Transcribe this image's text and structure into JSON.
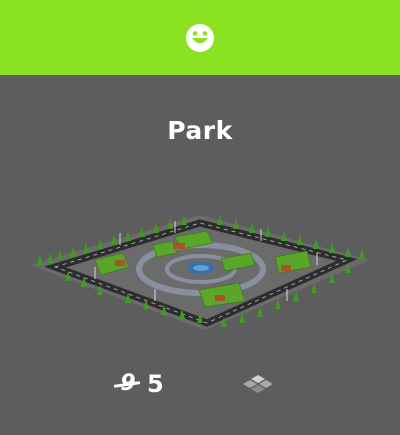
{
  "header": {
    "color": "#8be220",
    "icon": "smiley-icon"
  },
  "building": {
    "name": "Park",
    "illustration": "park-illustration",
    "cost_icon": "currency-icon",
    "cost": "5",
    "size_icon": "footprint-tiles-icon"
  }
}
